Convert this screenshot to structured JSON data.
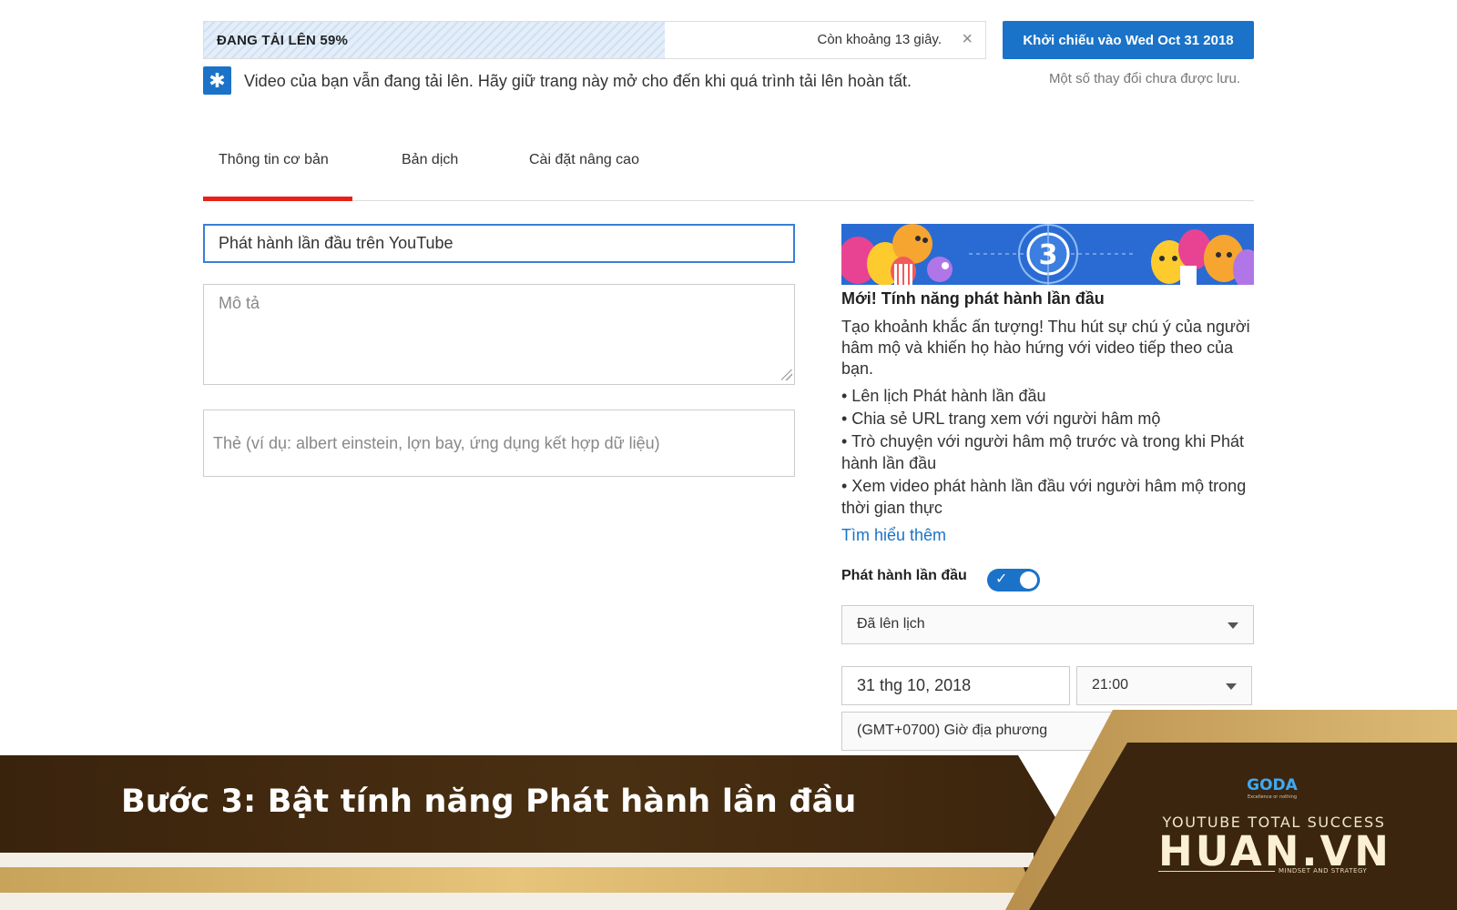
{
  "upload": {
    "progress": 0.59,
    "label": "ĐANG TẢI LÊN 59%",
    "remaining": "Còn khoảng 13 giây.",
    "close_symbol": "×"
  },
  "premiere_button": "Khởi chiếu vào Wed Oct 31 2018",
  "unsaved_notice": "Một số thay đổi chưa được lưu.",
  "notice": {
    "icon": "star-icon",
    "icon_symbol": "✱",
    "text": "Video của bạn vẫn đang tải lên. Hãy giữ trang này mở cho đến khi quá trình tải lên hoàn tất."
  },
  "tabs": [
    {
      "label": "Thông tin cơ bản",
      "active": true
    },
    {
      "label": "Bản dịch",
      "active": false
    },
    {
      "label": "Cài đặt nâng cao",
      "active": false
    }
  ],
  "form": {
    "title_value": "Phát hành lần đầu trên YouTube",
    "description_placeholder": "Mô tả",
    "tags_placeholder": "Thẻ (ví dụ: albert einstein, lợn bay, ứng dụng kết hợp dữ liệu)"
  },
  "premiere": {
    "banner_number": "3",
    "heading": "Mới! Tính năng phát hành lần đầu",
    "description": "Tạo khoảnh khắc ấn tượng! Thu hút sự chú ý của người hâm mộ và khiến họ hào hứng với video tiếp theo của bạn.",
    "features": [
      "• Lên lịch Phát hành lần đầu",
      "• Chia sẻ URL trang xem với người hâm mộ",
      "• Trò chuyện với người hâm mộ trước và trong khi Phát hành lần đầu",
      "• Xem video phát hành lần đầu với người hâm mộ trong thời gian thực"
    ],
    "learn_more": "Tìm hiểu thêm",
    "toggle_label": "Phát hành lần đầu",
    "toggle_on": true,
    "toggle_check": "✓",
    "status": "Đã lên lịch",
    "date": "31 thg 10, 2018",
    "time": "21:00",
    "timezone": "(GMT+0700) Giờ địa phương"
  },
  "footer": {
    "step_text": "Bước 3: Bật tính năng Phát hành lần đầu",
    "logo_text": "GODA",
    "logo_tagline": "Excellence or nothing",
    "brand_tagline": "YOUTUBE TOTAL SUCCESS",
    "brand_name": "HUAN.VN",
    "brand_sub": "MINDSET AND STRATEGY"
  },
  "colors": {
    "accent_blue": "#1a73c8",
    "tab_active_red": "#e62117",
    "banner_dark": "#3d2810",
    "banner_gold": "#d9b46c"
  }
}
